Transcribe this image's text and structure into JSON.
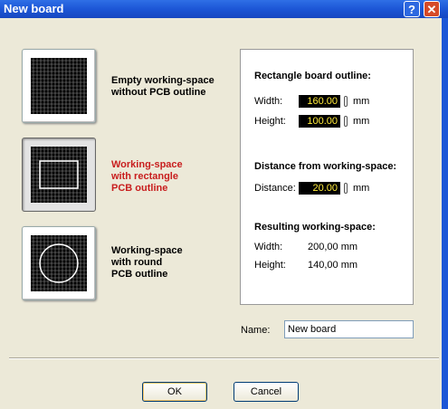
{
  "window": {
    "title": "New board"
  },
  "titlebar": {
    "help_label": "?",
    "close_label": "✕"
  },
  "options": [
    {
      "lines": [
        "Empty working-space",
        "without PCB outline"
      ],
      "selected": false,
      "icon": "grid-empty-icon"
    },
    {
      "lines": [
        "Working-space",
        "with rectangle",
        "PCB outline"
      ],
      "selected": true,
      "icon": "grid-rectangle-icon"
    },
    {
      "lines": [
        "Working-space",
        "with round",
        "PCB outline"
      ],
      "selected": false,
      "icon": "grid-round-icon"
    }
  ],
  "panel": {
    "rect_heading": "Rectangle board outline:",
    "width_label": "Width:",
    "width_value": "160.00",
    "height_label": "Height:",
    "height_value": "100.00",
    "unit": "mm",
    "distance_heading": "Distance from working-space:",
    "distance_label": "Distance:",
    "distance_value": "20.00",
    "result_heading": "Resulting working-space:",
    "result_width_label": "Width:",
    "result_width_value": "200,00 mm",
    "result_height_label": "Height:",
    "result_height_value": "140,00 mm"
  },
  "name": {
    "label": "Name:",
    "value": "New board"
  },
  "buttons": {
    "ok": "OK",
    "cancel": "Cancel"
  },
  "colors": {
    "titlebar": "#1c56d6",
    "selected_label": "#c81e1e",
    "value_bg": "#000000",
    "value_fg": "#ffeb3b"
  }
}
